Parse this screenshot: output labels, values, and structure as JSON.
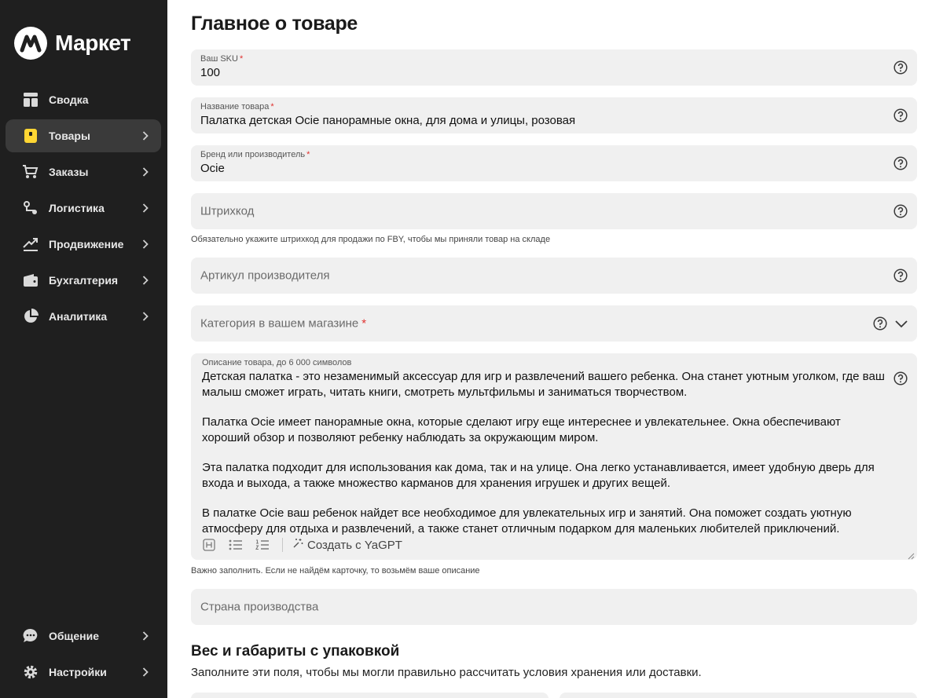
{
  "brand": {
    "name": "Маркет"
  },
  "nav": {
    "items": [
      {
        "label": "Сводка",
        "icon": "dashboard-icon",
        "chevron": false,
        "active": false
      },
      {
        "label": "Товары",
        "icon": "products-icon",
        "chevron": true,
        "active": true
      },
      {
        "label": "Заказы",
        "icon": "cart-icon",
        "chevron": true,
        "active": false
      },
      {
        "label": "Логистика",
        "icon": "logistics-icon",
        "chevron": true,
        "active": false
      },
      {
        "label": "Продвижение",
        "icon": "trend-icon",
        "chevron": true,
        "active": false
      },
      {
        "label": "Бухгалтерия",
        "icon": "wallet-icon",
        "chevron": true,
        "active": false
      },
      {
        "label": "Аналитика",
        "icon": "pie-chart-icon",
        "chevron": true,
        "active": false
      }
    ],
    "bottom": [
      {
        "label": "Общение",
        "icon": "chat-icon"
      },
      {
        "label": "Настройки",
        "icon": "gear-icon"
      }
    ]
  },
  "page": {
    "title": "Главное о товаре"
  },
  "form": {
    "sku": {
      "label": "Ваш SKU",
      "required": "*",
      "value": "100"
    },
    "name": {
      "label": "Название товара",
      "required": "*",
      "value": "Палатка детская Ocie панорамные окна, для дома и улицы, розовая"
    },
    "brand": {
      "label": "Бренд или производитель",
      "required": "*",
      "value": "Ocie"
    },
    "barcode": {
      "placeholder": "Штрихкод",
      "hint": "Обязательно укажите штрихкод для продажи по FBY, чтобы мы приняли товар на складе"
    },
    "article": {
      "placeholder": "Артикул производителя"
    },
    "category": {
      "placeholder": "Категория в вашем магазине",
      "required": "*"
    },
    "description": {
      "label": "Описание товара, до 6 000 символов",
      "paragraphs": [
        "Детская палатка - это незаменимый аксессуар для игр и развлечений вашего ребенка. Она станет уютным уголком, где ваш малыш сможет играть, читать книги, смотреть мультфильмы и заниматься творчеством.",
        "Палатка Ocie имеет панорамные окна, которые сделают игру еще интереснее и увлекательнее. Окна обеспечивают хороший обзор и позволяют ребенку наблюдать за окружающим миром.",
        "Эта палатка подходит для использования как дома, так и на улице. Она легко устанавливается, имеет удобную дверь для входа и выхода, а также множество карманов для хранения игрушек и других вещей.",
        "В палатке Ocie ваш ребенок найдет все необходимое для увлекательных игр и занятий. Она поможет создать уютную атмосферу для отдыха и развлечений, а также станет отличным подарком для маленьких любителей приключений."
      ],
      "yagpt_label": "Создать с YaGPT",
      "hint": "Важно заполнить. Если не найдём карточку, то возьмём ваше описание"
    },
    "country": {
      "placeholder": "Страна производства"
    }
  },
  "dimensions": {
    "title": "Вес и габариты с упаковкой",
    "subtitle": "Заполните эти поля, чтобы мы могли правильно рассчитать условия хранения или доставки."
  },
  "colors": {
    "sidebar_bg": "#1f1f1f",
    "field_bg": "#f0f0f0",
    "required": "#e0312e"
  }
}
